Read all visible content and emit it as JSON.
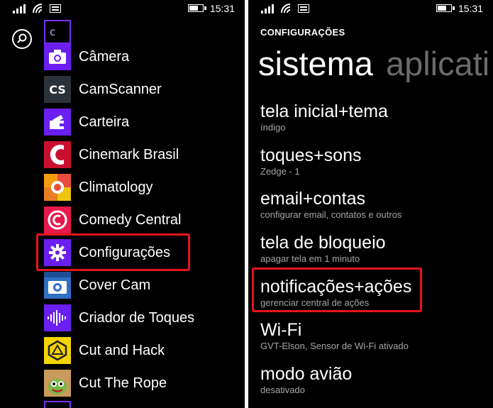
{
  "status_bar": {
    "time": "15:31"
  },
  "left": {
    "letter_group": "c",
    "apps": [
      {
        "name": "Câmera",
        "icon": "camera-icon",
        "color": "#6a1ff0"
      },
      {
        "name": "CamScanner",
        "icon": "camscanner-icon",
        "tile_text": "CS",
        "color": "#2b3138"
      },
      {
        "name": "Carteira",
        "icon": "wallet-icon",
        "color": "#6a1ff0"
      },
      {
        "name": "Cinemark Brasil",
        "icon": "cinemark-icon",
        "color": "#c8102e"
      },
      {
        "name": "Climatology",
        "icon": "climatology-icon",
        "color": "#f2f2f2"
      },
      {
        "name": "Comedy Central",
        "icon": "comedy-central-icon",
        "color": "#e5194b"
      },
      {
        "name": "Configurações",
        "icon": "gear-icon",
        "color": "#6a1ff0"
      },
      {
        "name": "Cover Cam",
        "icon": "cover-cam-icon",
        "color": "#2f6fc6"
      },
      {
        "name": "Criador de Toques",
        "icon": "ringtone-maker-icon",
        "color": "#6a1ff0"
      },
      {
        "name": "Cut and Hack",
        "icon": "cut-and-hack-icon",
        "color": "#f5d400"
      },
      {
        "name": "Cut The Rope",
        "icon": "cut-the-rope-icon",
        "color": "#7ab648"
      }
    ]
  },
  "right": {
    "header": "CONFIGURAÇÕES",
    "pivot": {
      "active": "sistema",
      "inactive": "aplicati"
    },
    "settings": [
      {
        "title": "tela inicial+tema",
        "subtitle": "índigo"
      },
      {
        "title": "toques+sons",
        "subtitle": "Zedge - 1"
      },
      {
        "title": "email+contas",
        "subtitle": "configurar email, contatos e outros"
      },
      {
        "title": "tela de bloqueio",
        "subtitle": "apagar tela em 1 minuto"
      },
      {
        "title": "notificações+ações",
        "subtitle": "gerenciar central de ações"
      },
      {
        "title": "Wi-Fi",
        "subtitle": "GVT-Elson, Sensor de Wi-Fi ativado"
      },
      {
        "title": "modo avião",
        "subtitle": "desativado"
      }
    ]
  },
  "colors": {
    "accent": "#6a1ff0",
    "highlight": "#e3161b",
    "subtitle": "#a5a5a5",
    "pivot_inactive": "#6b6b6b"
  }
}
